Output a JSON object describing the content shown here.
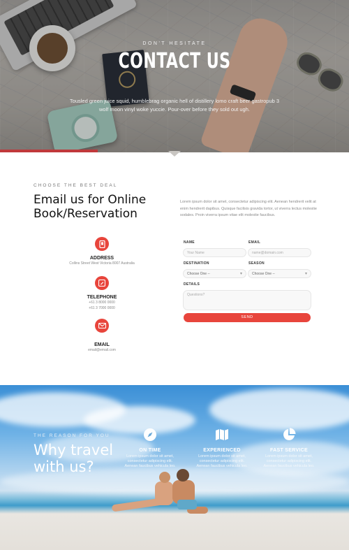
{
  "hero": {
    "kicker": "DON'T HESITATE",
    "title": "CONTACT US",
    "subtitle": "Tousled green juice squid, humblebrag organic hell of distillery lomo craft beer gastropub 3 wolf moon vinyl woke yuccie. Pour-over before they sold out ugh."
  },
  "contact": {
    "kicker": "CHOOSE THE BEST DEAL",
    "heading_line1": "Email us for Online",
    "heading_line2": "Book/Reservation",
    "description": "Lorem ipsum dolor sit amet, consectetur adipiscing elit. Aenean hendrerit velit at enim hendrerit dapibus. Quisque facilisis gravida tortor, ut viverra lectus molestie sodales. Proin viverra ipsum vitae elit molestie faucibus.",
    "address": {
      "label": "ADDRESS",
      "value": "Collins Street West Victoria 8007 Australia"
    },
    "telephone": {
      "label": "TELEPHONE",
      "line1": "+61 3 8000 0000",
      "line2": "+61 3 7000 0000"
    },
    "email": {
      "label": "EMAIL",
      "value": "email@email.com"
    }
  },
  "form": {
    "name_label": "NAME",
    "name_placeholder": "Your Name",
    "email_label": "EMAIL",
    "email_placeholder": "name@domain.com",
    "destination_label": "DESTINATION",
    "destination_value": "Choose One --",
    "season_label": "SEASON",
    "season_value": "Choose One --",
    "details_label": "DETAILS",
    "details_placeholder": "Questions?",
    "send_label": "SEND"
  },
  "why": {
    "kicker": "THE REASON FOR YOU",
    "heading_line1": "Why travel",
    "heading_line2": "with us?",
    "features": [
      {
        "icon": "compass-icon",
        "title": "ON TIME",
        "text": "Lorem ipsum dolor sit amet, consectetur adipiscing elit. Aenean faucibus vehicula leo."
      },
      {
        "icon": "map-icon",
        "title": "EXPERIENCED",
        "text": "Lorem ipsum dolor sit amet, consectetur adipiscing elit. Aenean faucibus vehicula leo."
      },
      {
        "icon": "pie-chart-icon",
        "title": "FAST SERVICE",
        "text": "Lorem ipsum dolor sit amet, consectetur adipiscing elit. Aenean faucibus vehicula leo."
      }
    ]
  },
  "colors": {
    "accent": "#e8453c",
    "heading": "#111111",
    "muted": "#888888"
  }
}
